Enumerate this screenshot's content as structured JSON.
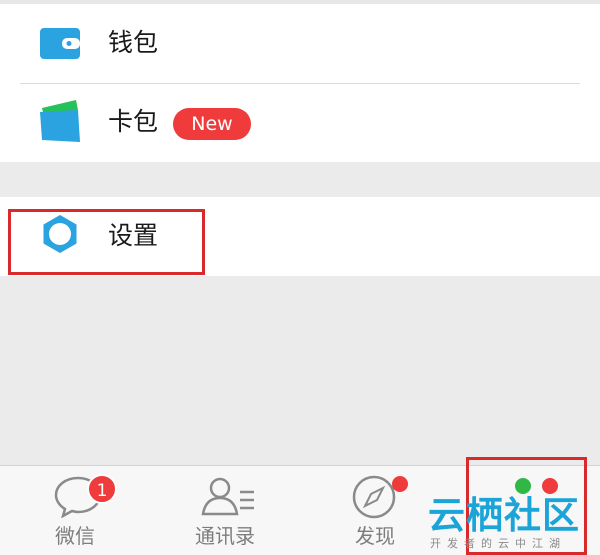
{
  "menu": {
    "wallet_label": "钱包",
    "cards_label": "卡包",
    "cards_badge": "New",
    "settings_label": "设置"
  },
  "tabbar": {
    "tabs": [
      {
        "label": "微信",
        "badge": "1"
      },
      {
        "label": "通讯录"
      },
      {
        "label": "发现"
      },
      {
        "label": ""
      }
    ]
  },
  "watermark": {
    "title": "云栖社区",
    "subtitle": "开发者的云中江湖"
  },
  "colors": {
    "accent_blue": "#2aa3e0",
    "badge_red": "#ef3b3b",
    "highlight_red": "#d8292b",
    "cards_green": "#26c15a"
  }
}
